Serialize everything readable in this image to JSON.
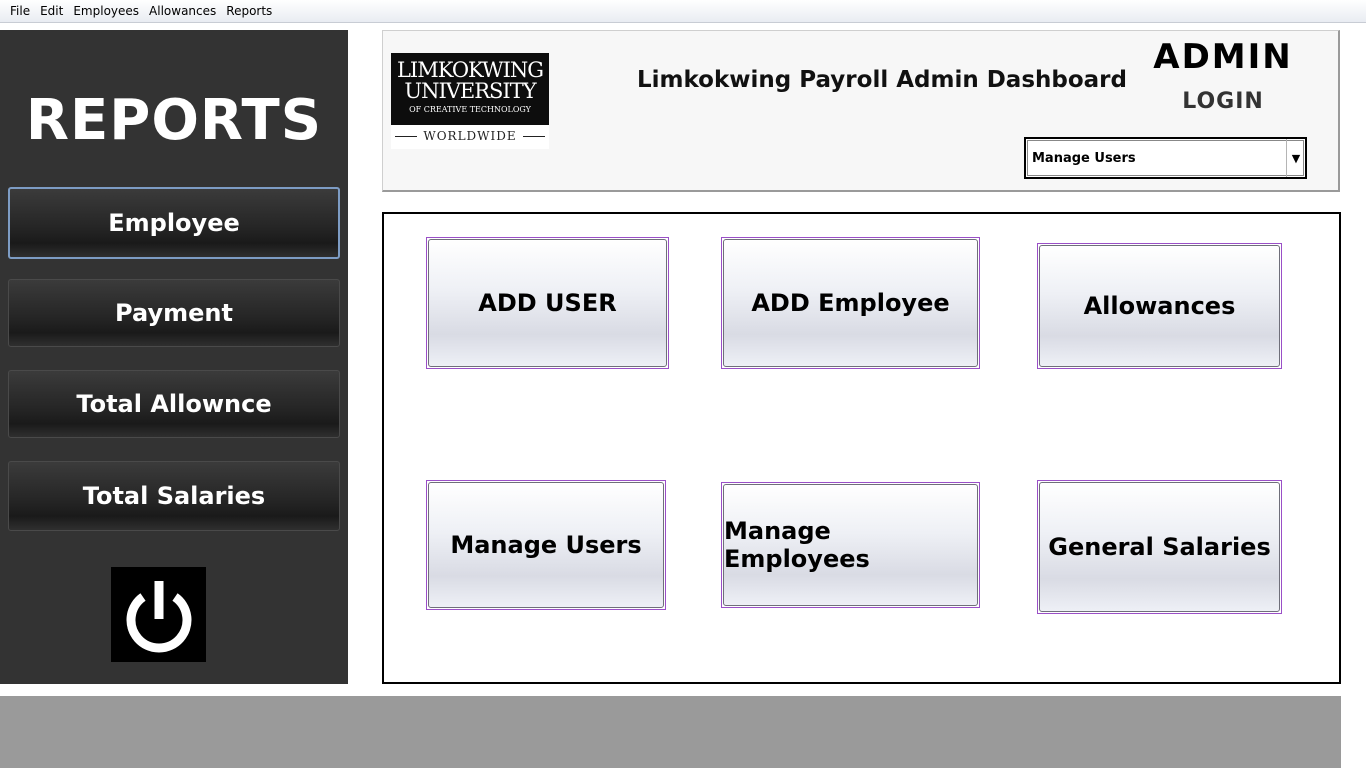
{
  "menubar": {
    "items": [
      "File",
      "Edit",
      "Employees",
      "Allowances",
      "Reports"
    ]
  },
  "sidebar": {
    "title": "REPORTS",
    "buttons": [
      "Employee",
      "Payment",
      "Total Allownce",
      "Total Salaries"
    ],
    "power_icon": "power-icon"
  },
  "header": {
    "logo": {
      "line1": "LIMKOKWING",
      "line2": "UNIVERSITY",
      "line3": "OF CREATIVE TECHNOLOGY",
      "line4": "WORLDWIDE"
    },
    "title": "Limkokwing Payroll Admin Dashboard",
    "admin_label": "ADMIN",
    "login_label": "LOGIN",
    "select": {
      "value": "Manage Users"
    }
  },
  "main": {
    "tiles": [
      "ADD USER",
      "ADD Employee",
      "Allowances",
      "Manage Users",
      "Manage Employees",
      "General Salaries"
    ]
  },
  "colors": {
    "sidebar_bg": "#333333",
    "tile_border": "#9a4fc7",
    "footer_bg": "#9a9a9a"
  }
}
